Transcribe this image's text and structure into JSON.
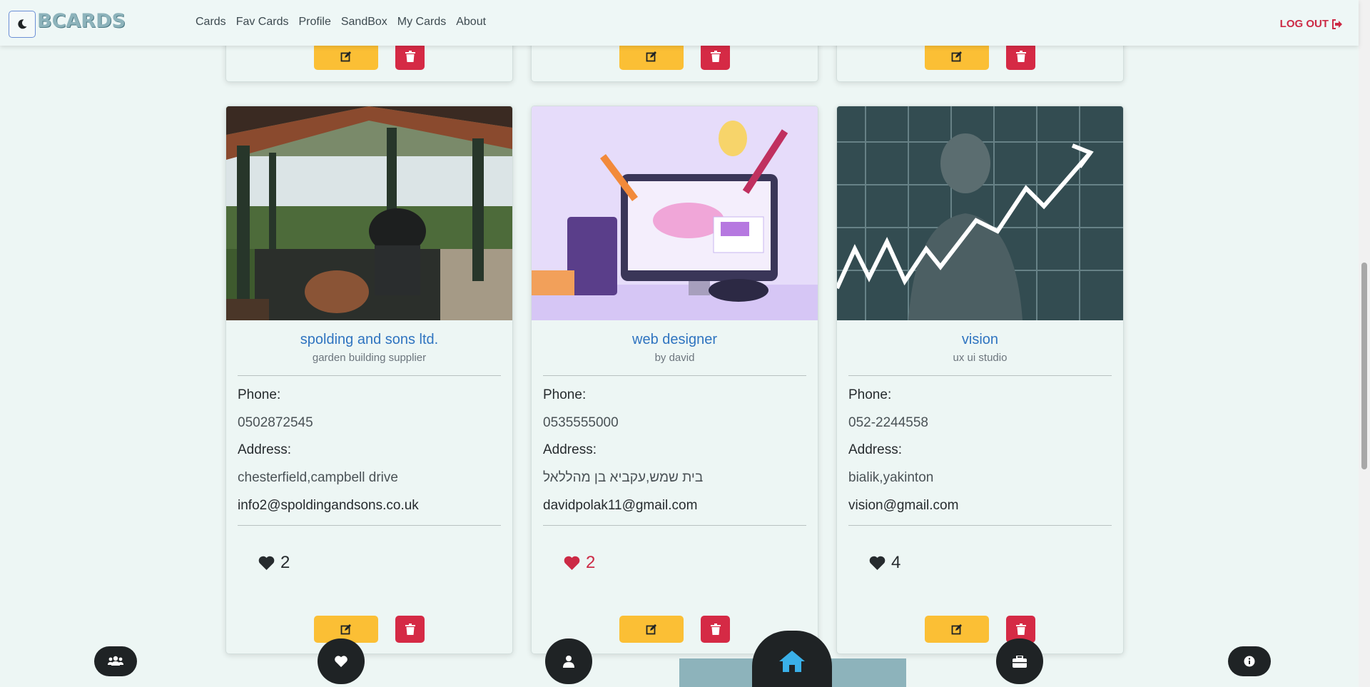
{
  "navbar": {
    "logo": "BCARDS",
    "links": [
      "Cards",
      "Fav Cards",
      "Profile",
      "SandBox",
      "My Cards",
      "About"
    ],
    "logout_label": "LOG OUT"
  },
  "cards": [
    {
      "title": "spolding and sons ltd.",
      "subtitle": "garden building supplier",
      "phone_label": "Phone:",
      "phone": "0502872545",
      "address_label": "Address:",
      "address": "chesterfield,campbell drive",
      "email": "info2@spoldingandsons.co.uk",
      "likes": "2",
      "liked": false
    },
    {
      "title": "web designer",
      "subtitle": "by david",
      "phone_label": "Phone:",
      "phone": "0535555000",
      "address_label": "Address:",
      "address": "בית שמש,עקביא בן מהללאל",
      "email": "davidpolak11@gmail.com",
      "likes": "2",
      "liked": true
    },
    {
      "title": "vision",
      "subtitle": "ux ui studio",
      "phone_label": "Phone:",
      "phone": "052-2244558",
      "address_label": "Address:",
      "address": "bialik,yakinton",
      "email": "vision@gmail.com",
      "likes": "4",
      "liked": false
    }
  ],
  "bottom_nav": [
    "users-icon",
    "heart-icon",
    "user-icon",
    "home-icon",
    "briefcase-icon",
    "info-icon"
  ],
  "colors": {
    "accent_blue": "#2f74c0",
    "edit_yellow": "#fbbf35",
    "delete_red": "#d52a45",
    "liked_red": "#cc2a45",
    "home_icon": "#3ab0e8"
  }
}
